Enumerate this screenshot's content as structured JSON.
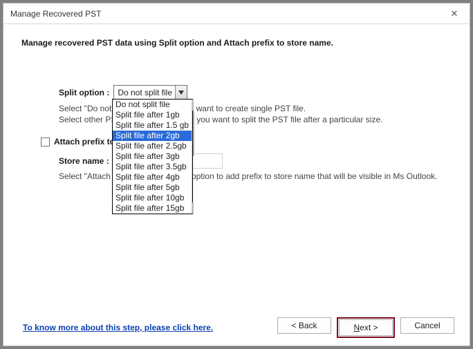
{
  "window": {
    "title": "Manage Recovered PST",
    "close_glyph": "✕"
  },
  "main": {
    "instructions": "Manage recovered PST data using Split option and Attach prefix to store name.",
    "split_label": "Split option :",
    "split_selected": "Do not split file",
    "split_help_line1": "Select \"Do not split file\" option, if you want to create single PST file.",
    "split_help_line2": "Select other PST size option, in case you want to split the PST file after a particular size.",
    "prefix_label": "Attach prefix to store name",
    "prefix_checked": false,
    "store_label": "Store name :",
    "store_value": "",
    "prefix_help": "Select \"Attach prefix to store name\" option to add prefix to store name that will be visible in Ms Outlook."
  },
  "dropdown": {
    "options": [
      "Do not split file",
      "Split file after 1gb",
      "Split file after 1.5 gb",
      "Split file after 2gb",
      "Split file after 2.5gb",
      "Split file after 3gb",
      "Split file after 3.5gb",
      "Split file after 4gb",
      "Split file after 5gb",
      "Split file after 10gb",
      "Split file after 15gb"
    ],
    "highlighted_index": 3
  },
  "footer": {
    "help_link": "To know more about this step, please click here.",
    "back": "< Back",
    "next_underline": "N",
    "next_rest": "ext >",
    "cancel": "Cancel"
  }
}
